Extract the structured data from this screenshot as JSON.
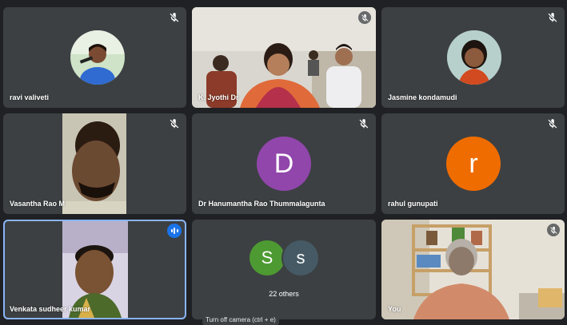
{
  "participants": [
    {
      "name": "ravi valiveti",
      "muted": true
    },
    {
      "name": "K. Jyothi Dr",
      "muted": true
    },
    {
      "name": "Jasmine kondamudi",
      "muted": true
    },
    {
      "name": "Vasantha Rao M",
      "muted": true
    },
    {
      "name": "Dr Hanumantha Rao Thummalagunta",
      "muted": true,
      "avatar_letter": "D",
      "avatar_color": "#9146ab"
    },
    {
      "name": "rahul gunupati",
      "muted": true,
      "avatar_letter": "r",
      "avatar_color": "#ef6c00"
    },
    {
      "name": "Venkata sudheer kumar",
      "muted": false,
      "speaking": true
    },
    {
      "others_label": "22 others",
      "avatars": [
        {
          "letter": "S",
          "color": "#4e9a32"
        },
        {
          "letter": "s",
          "color": "#455a64"
        }
      ]
    },
    {
      "name": "You",
      "muted": true
    }
  ],
  "tooltip": "Turn off camera (ctrl + e)",
  "icons": {
    "mute": "mic-off-icon",
    "speaking": "audio-level-icon"
  }
}
